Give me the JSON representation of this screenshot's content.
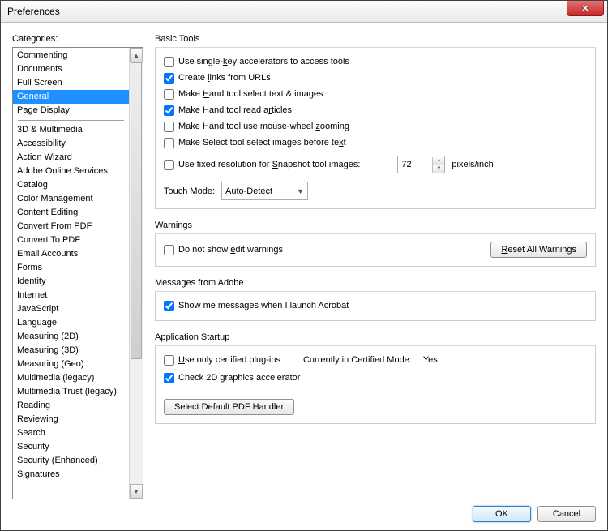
{
  "window": {
    "title": "Preferences"
  },
  "sidebar": {
    "label": "Categories:",
    "group1": [
      "Commenting",
      "Documents",
      "Full Screen",
      "General",
      "Page Display"
    ],
    "selected": "General",
    "group2": [
      "3D & Multimedia",
      "Accessibility",
      "Action Wizard",
      "Adobe Online Services",
      "Catalog",
      "Color Management",
      "Content Editing",
      "Convert From PDF",
      "Convert To PDF",
      "Email Accounts",
      "Forms",
      "Identity",
      "Internet",
      "JavaScript",
      "Language",
      "Measuring (2D)",
      "Measuring (3D)",
      "Measuring (Geo)",
      "Multimedia (legacy)",
      "Multimedia Trust (legacy)",
      "Reading",
      "Reviewing",
      "Search",
      "Security",
      "Security (Enhanced)",
      "Signatures"
    ]
  },
  "basicTools": {
    "title": "Basic Tools",
    "opts": {
      "accel": {
        "checked": false,
        "pre": "Use single-",
        "u": "k",
        "post": "ey accelerators to access tools"
      },
      "links": {
        "checked": true,
        "pre": "Create ",
        "u": "l",
        "post": "inks from URLs"
      },
      "handSelect": {
        "checked": false,
        "pre": "Make ",
        "u": "H",
        "post": "and tool select text & images"
      },
      "handArticles": {
        "checked": true,
        "pre": "Make Hand tool read a",
        "u": "r",
        "post": "ticles"
      },
      "handWheel": {
        "checked": false,
        "pre": "Make Hand tool use mouse-wheel ",
        "u": "z",
        "post": "ooming"
      },
      "selectImages": {
        "checked": false,
        "pre": "Make Select tool select images before te",
        "u": "x",
        "post": "t"
      }
    },
    "snapshot": {
      "checked": false,
      "pre": "Use fixed resolution for ",
      "u": "S",
      "post": "napshot tool images:",
      "value": "72",
      "unit": "pixels/inch"
    },
    "touchMode": {
      "pre": "T",
      "u": "o",
      "post": "uch Mode:",
      "value": "Auto-Detect"
    }
  },
  "warnings": {
    "title": "Warnings",
    "noEdit": {
      "checked": false,
      "pre": "Do not show ",
      "u": "e",
      "post": "dit warnings"
    },
    "resetBtn": {
      "pre": "",
      "u": "R",
      "post": "eset All Warnings"
    }
  },
  "messages": {
    "title": "Messages from Adobe",
    "show": {
      "checked": true,
      "label": "Show me messages when I launch Acrobat"
    }
  },
  "startup": {
    "title": "Application Startup",
    "certified": {
      "checked": false,
      "pre": "",
      "u": "U",
      "post": "se only certified plug-ins"
    },
    "certModeLabel": "Currently in Certified Mode:",
    "certModeValue": "Yes",
    "gfx": {
      "checked": true,
      "label": "Check 2D graphics accelerator"
    },
    "pdfHandlerBtn": "Select Default PDF Handler"
  },
  "footer": {
    "ok": "OK",
    "cancel": "Cancel"
  }
}
